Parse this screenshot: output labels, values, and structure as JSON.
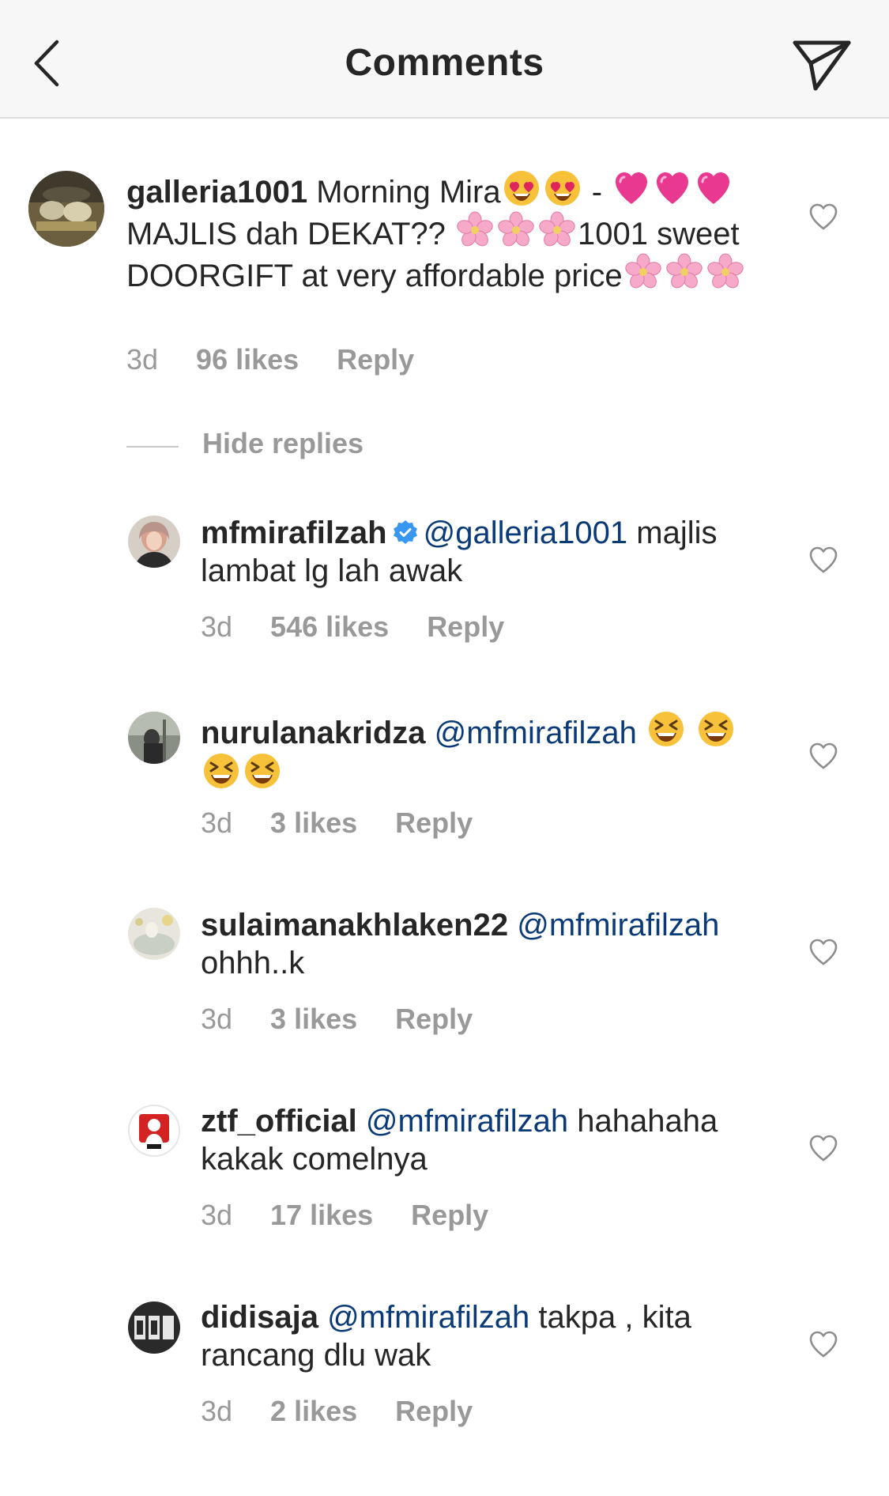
{
  "header": {
    "title": "Comments",
    "back_icon": "chevron-left-icon",
    "share_icon": "paper-plane-icon"
  },
  "colors": {
    "text": "#262626",
    "muted": "#999999",
    "mention": "#0a3a78",
    "verified": "#3897f0",
    "header_bg": "#f7f7f7"
  },
  "main_comment": {
    "username": "galleria1001",
    "text_part1": "Morning Mira",
    "text_dash": "-",
    "text_part2": "MAJLIS dah DEKAT??",
    "text_part3": "1001 sweet DOORGIFT at very affordable price",
    "time": "3d",
    "likes": "96 likes",
    "reply": "Reply"
  },
  "hide_replies": "Hide replies",
  "replies": [
    {
      "username": "mfmirafilzah",
      "mention": "@galleria1001",
      "text": "majlis lambat lg lah awak",
      "time": "3d",
      "likes": "546 likes",
      "reply": "Reply"
    },
    {
      "username": "nurulanakridza",
      "mention": "@mfmirafilzah",
      "text": "",
      "time": "3d",
      "likes": "3 likes",
      "reply": "Reply"
    },
    {
      "username": "sulaimanakhlaken22",
      "mention": "@mfmirafilzah",
      "text": "ohhh..k",
      "time": "3d",
      "likes": "3 likes",
      "reply": "Reply"
    },
    {
      "username": "ztf_official",
      "mention": "@mfmirafilzah",
      "text": "hahahaha kakak comelnya",
      "time": "3d",
      "likes": "17 likes",
      "reply": "Reply"
    },
    {
      "username": "didisaja",
      "mention": "@mfmirafilzah",
      "text": "takpa , kita rancang dlu wak",
      "time": "3d",
      "likes": "2 likes",
      "reply": "Reply"
    }
  ]
}
